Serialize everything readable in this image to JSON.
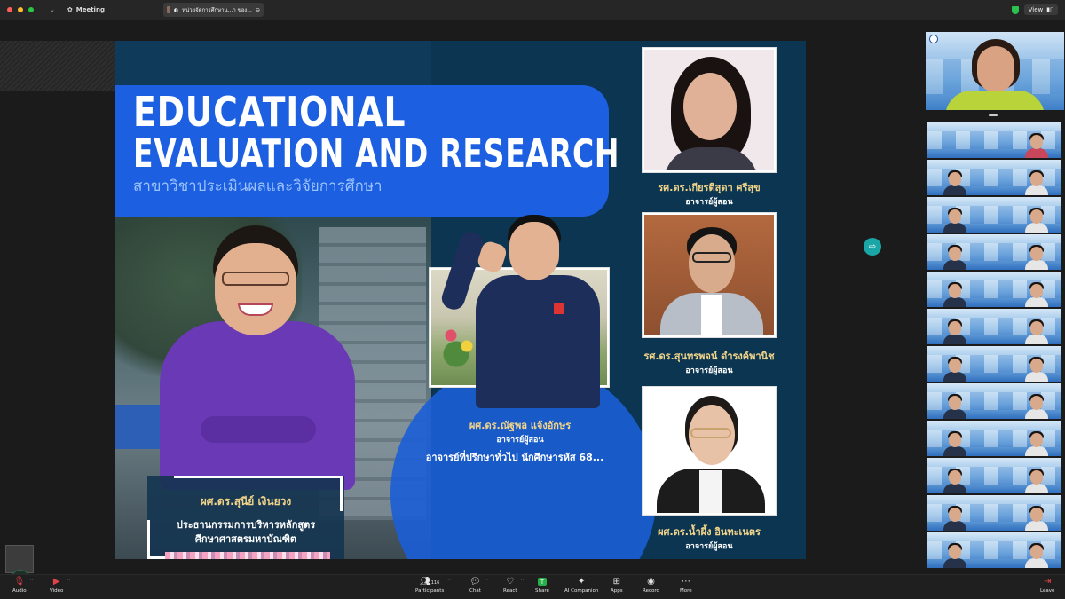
{
  "topbar": {
    "meeting_label": "Meeting",
    "share_title": "หน่วยจัดการศึกษาน...า ของ...",
    "view_label": "View"
  },
  "slide": {
    "title_line1": "EDUCATIONAL",
    "title_line2": "EVALUATION AND RESEARCH",
    "title_th": "สาขาวิชาประเมินผลและวิจัยการศึกษา",
    "main_person": {
      "name": "ผศ.ดร.สุนีย์  เงินยวง",
      "role_line1": "ประธานกรรมการบริหารหลักสูตร",
      "role_line2": "ศึกษาศาสตรมหาบัณฑิต"
    },
    "center_person": {
      "name": "ผศ.ดร.ณัฐพล  แจ้งอักษร",
      "role": "อาจารย์ผู้สอน",
      "advisor": "อาจารย์ที่ปรึกษาทั่วไป  นักศึกษารหัส  68..."
    },
    "right_people": [
      {
        "name": "รศ.ดร.เกียรติสุดา  ศรีสุข",
        "role": "อาจารย์ผู้สอน"
      },
      {
        "name": "รศ.ดร.สุนทรพจน์  ดำรงค์พานิช",
        "role": "อาจารย์ผู้สอน"
      },
      {
        "name": "ผศ.ดร.น้ำผึ้ง  อินทะเนตร",
        "role": "อาจารย์ผู้สอน"
      }
    ]
  },
  "toolbar": {
    "audio": "Audio",
    "video": "Video",
    "participants": "Participants",
    "participants_count": "116",
    "chat": "Chat",
    "react": "React",
    "share": "Share",
    "ai_companion": "AI Companion",
    "apps": "Apps",
    "record": "Record",
    "more": "More",
    "leave": "Leave"
  },
  "colors": {
    "slide_blue": "#1c5fe0",
    "slide_navy": "#0b3550",
    "name_gold": "#f2d58a",
    "share_green": "#27b04a",
    "leave_red": "#e0414a"
  }
}
